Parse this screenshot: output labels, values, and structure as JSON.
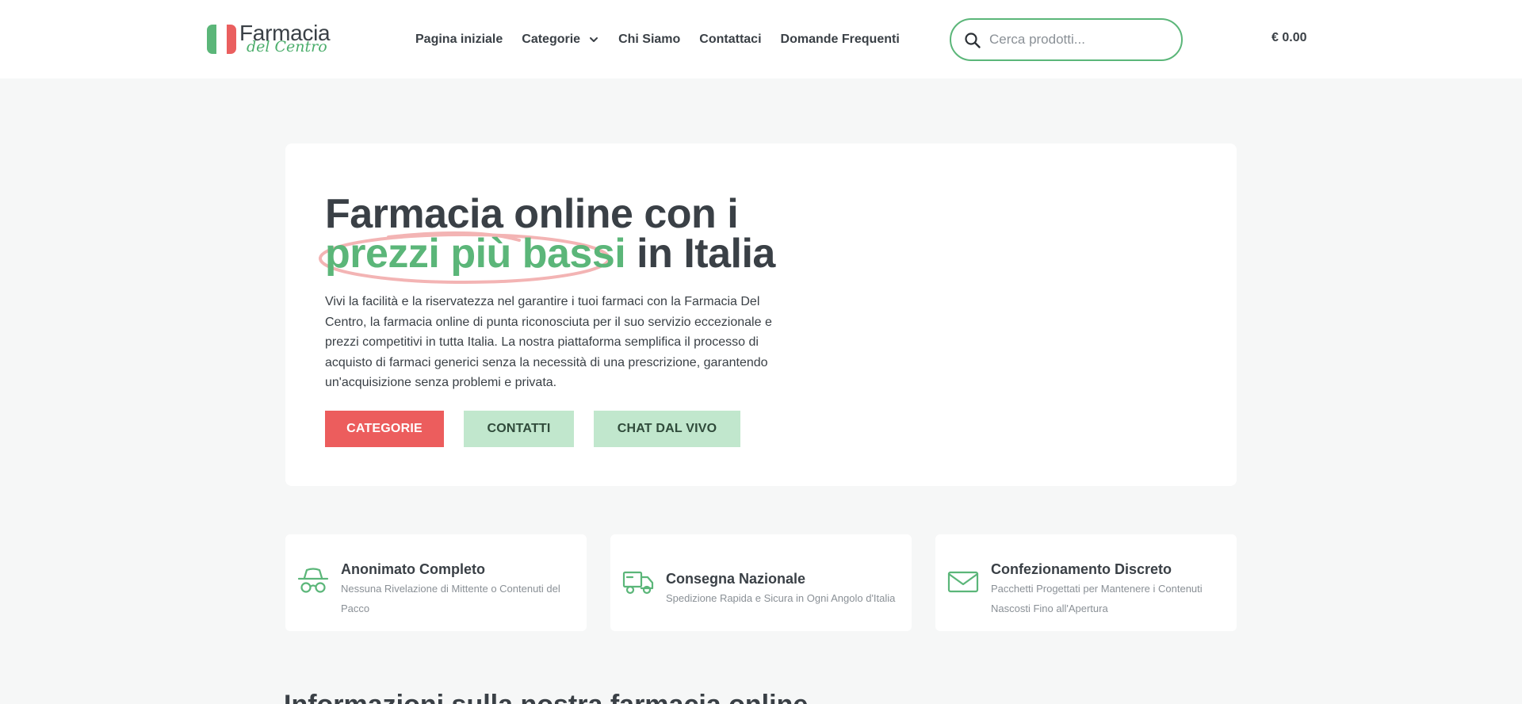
{
  "header": {
    "logo": {
      "name": "Farmacia",
      "sub": "del Centro"
    },
    "nav": [
      {
        "label": "Pagina iniziale"
      },
      {
        "label": "Categorie"
      },
      {
        "label": "Chi Siamo"
      },
      {
        "label": "Contattaci"
      },
      {
        "label": "Domande Frequenti"
      }
    ],
    "search": {
      "placeholder": "Cerca prodotti...",
      "value": ""
    },
    "cart_total": "€ 0.00"
  },
  "hero": {
    "title_line1": "Farmacia online con i",
    "title_highlight": "prezzi più bassi",
    "title_line2_rest": "in Italia",
    "description": "Vivi la facilità e la riservatezza nel garantire i tuoi farmaci con la Farmacia Del Centro, la farmacia online di punta riconosciuta per il suo servizio eccezionale e prezzi competitivi in tutta Italia. La nostra piattaforma semplifica il processo di acquisto di farmaci generici senza la necessità di una prescrizione, garantendo un'acquisizione senza problemi e privata.",
    "buttons": {
      "categories": "CATEGORIE",
      "contacts": "CONTATTI",
      "chat": "CHAT DAL VIVO"
    }
  },
  "features": [
    {
      "icon": "spy-hat-glasses-icon",
      "title": "Anonimato Completo",
      "desc": "Nessuna Rivelazione di Mittente o Contenuti del Pacco"
    },
    {
      "icon": "delivery-truck-icon",
      "title": "Consegna Nazionale",
      "desc": "Spedizione Rapida e Sicura in Ogni Angolo d'Italia"
    },
    {
      "icon": "envelope-icon",
      "title": "Confezionamento Discreto",
      "desc": "Pacchetti Progettati per Mantenere i Contenuti Nascosti Fino all'Apertura"
    }
  ],
  "next_section_title": "Informazioni sulla nostra farmacia online",
  "colors": {
    "accent_green": "#5bb679",
    "accent_red": "#ec5d5d",
    "light_green": "#c1e7cd",
    "text_dark": "#3a4046",
    "page_bg": "#f6f7f7"
  }
}
